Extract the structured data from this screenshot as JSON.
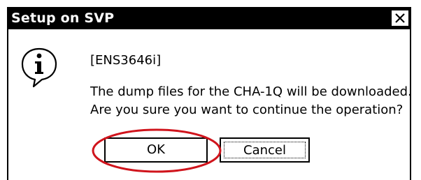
{
  "window": {
    "title": "Setup on SVP",
    "close_symbol": "✕"
  },
  "icons": {
    "info": "info-icon",
    "close": "close-icon"
  },
  "message": {
    "code": "[ENS3646i]",
    "line1": "The dump files for the CHA-1Q will be downloaded.",
    "line2": "Are you sure you want to continue the operation?"
  },
  "buttons": {
    "ok_label": "OK",
    "cancel_label": "Cancel"
  },
  "colors": {
    "titlebar_bg": "#000000",
    "titlebar_text": "#ffffff",
    "highlight": "#d0141c"
  }
}
